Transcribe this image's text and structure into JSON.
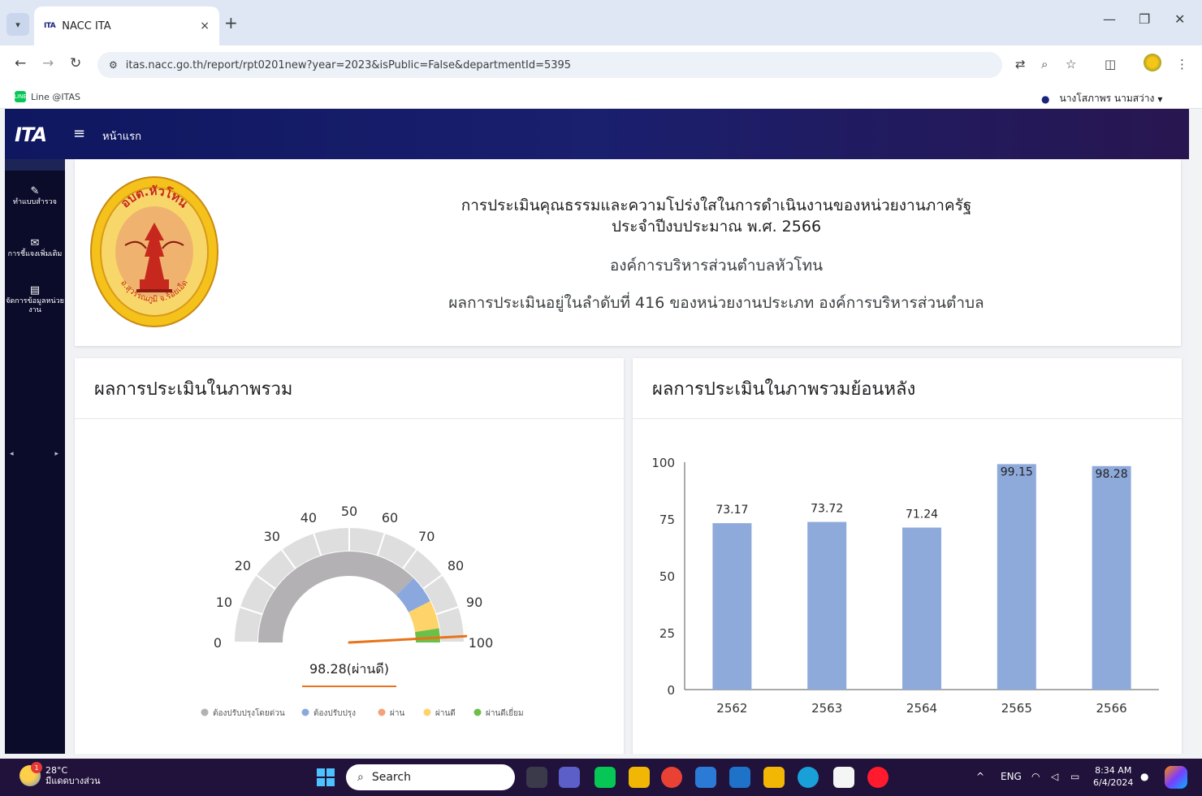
{
  "browser": {
    "tab_title": "NACC ITA",
    "tab_favicon": "ITA",
    "tab_close": "×",
    "new_tab": "+",
    "url": "itas.nacc.go.th/report/rpt0201new?year=2023&isPublic=False&departmentId=5395",
    "bookmark": "Line @ITAS",
    "bookmark_badge": "LINE",
    "win_minimize": "—",
    "win_restore": "❐",
    "win_close": "✕"
  },
  "user": {
    "name": "นางโสภาพร นามสว่าง",
    "caret": "▾"
  },
  "app": {
    "logo": "ITA",
    "home_link": "หน้าแรก"
  },
  "sidebar": {
    "items": [
      {
        "label": "ทำแบบสำรวจ",
        "icon": "edit-icon"
      },
      {
        "label": "การชี้แจงเพิ่มเติม",
        "icon": "mail-icon"
      },
      {
        "label": "จัดการข้อมูลหน่วยงาน",
        "icon": "document-icon"
      }
    ],
    "prev": "◂",
    "next": "▸"
  },
  "info": {
    "title_line1": "การประเมินคุณธรรมและความโปร่งใสในการดำเนินงานของหน่วยงานภาครัฐ",
    "title_line2": "ประจำปีงบประมาณ พ.ศ. 2566",
    "organization": "องค์การบริหารส่วนตำบลหัวโทน",
    "ranking": "ผลการประเมินอยู่ในลำดับที่ 416 ของหน่วยงานประเภท องค์การบริหารส่วนตำบล",
    "emblem_top": "อบต.หัวโทน",
    "emblem_bottom": "อ.สุวรรณภูมิ จ.ร้อยเอ็ด"
  },
  "panels": {
    "gauge_title": "ผลการประเมินในภาพรวม",
    "history_title": "ผลการประเมินในภาพรวมย้อนหลัง"
  },
  "chart_data": [
    {
      "type": "gauge",
      "value": 98.28,
      "value_label": "98.28(ผ่านดี)",
      "min": 0,
      "max": 100,
      "ticks": [
        0,
        10,
        20,
        30,
        40,
        50,
        60,
        70,
        80,
        90,
        100
      ],
      "bands": [
        {
          "name": "ต้องปรับปรุงโดยด่วน",
          "from": 0,
          "to": 75,
          "color": "#b3b1b3"
        },
        {
          "name": "ต้องปรับปรุง",
          "from": 75,
          "to": 85,
          "color": "#8aa8de"
        },
        {
          "name": "ผ่าน",
          "from": 85,
          "to": 85,
          "color": "#f2a37a"
        },
        {
          "name": "ผ่านดี",
          "from": 85,
          "to": 95,
          "color": "#fdd36a"
        },
        {
          "name": "ผ่านดีเยี่ยม",
          "from": 95,
          "to": 100,
          "color": "#6cc04a"
        }
      ],
      "legend_position": "bottom",
      "needle_color": "#e8731a"
    },
    {
      "type": "bar",
      "categories": [
        "2562",
        "2563",
        "2564",
        "2565",
        "2566"
      ],
      "values": [
        73.17,
        73.72,
        71.24,
        99.15,
        98.28
      ],
      "value_labels": [
        "73.17",
        "73.72",
        "71.24",
        "99.15",
        "98.28"
      ],
      "ylim": [
        0,
        100
      ],
      "yticks": [
        0,
        25,
        50,
        75,
        100
      ],
      "bar_color": "#8eaadb",
      "grid": false
    }
  ],
  "taskbar": {
    "temperature": "28°C",
    "weather": "มีแดดบางส่วน",
    "notification_count": "1",
    "search_label": "Search",
    "lang": "ENG",
    "time": "8:34 AM",
    "date": "6/4/2024",
    "tray_up": "^"
  }
}
